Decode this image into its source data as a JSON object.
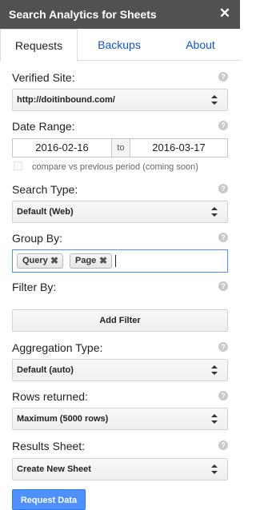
{
  "header": {
    "title": "Search Analytics for Sheets",
    "close_glyph": "✕"
  },
  "tabs": [
    {
      "label": "Requests",
      "active": true
    },
    {
      "label": "Backups",
      "active": false
    },
    {
      "label": "About",
      "active": false
    }
  ],
  "help_glyph": "?",
  "verified_site": {
    "label": "Verified Site:",
    "value": "http://doitinbound.com/"
  },
  "date_range": {
    "label": "Date Range:",
    "from": "2016-02-16",
    "separator": "to",
    "to": "2016-03-17",
    "compare_label": "compare vs previous period (coming soon)",
    "compare_checked": false
  },
  "search_type": {
    "label": "Search Type:",
    "value": "Default (Web)"
  },
  "group_by": {
    "label": "Group By:",
    "chips": [
      {
        "label": "Query"
      },
      {
        "label": "Page"
      }
    ],
    "remove_glyph": "✖"
  },
  "filter_by": {
    "label": "Filter By:",
    "add_button": "Add Filter"
  },
  "aggregation_type": {
    "label": "Aggregation Type:",
    "value": "Default (auto)"
  },
  "rows_returned": {
    "label": "Rows returned:",
    "value": "Maximum (5000 rows)"
  },
  "results_sheet": {
    "label": "Results Sheet:",
    "value": "Create New Sheet"
  },
  "request_button": "Request Data",
  "colors": {
    "header_bg": "#515151",
    "link": "#1155cc",
    "primary_button": "#4d90fe",
    "focus_border": "#4d90fe"
  },
  "icons": {
    "close": "close-icon",
    "help": "help-icon",
    "dropdown": "select-arrows-icon",
    "remove_chip": "remove-chip-icon"
  }
}
